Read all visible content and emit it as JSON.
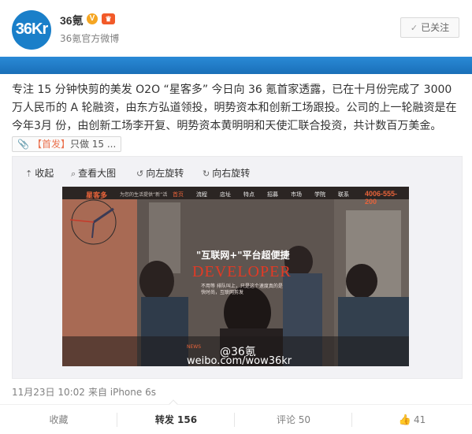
{
  "header": {
    "avatar_text": "36Kr",
    "name": "36氪",
    "verified_badge": "V",
    "member_badge": "♛",
    "subtitle": "36氪官方微博",
    "follow_label": "已关注",
    "follow_check": "✓"
  },
  "post": {
    "text": "专注 15 分钟快剪的美发 O2O “星客多” 今日向 36 氪首家透露，已在十月份完成了 3000 万人民币的 A 轮融资，由东方弘道领投，明势资本和创新工场跟投。公司的上一轮融资是在今年3月 份，由创新工场李开复、明势资本黄明明和天使汇联合投资，共计数百万美金。",
    "tag_clip": "📎",
    "tag_link": "【首发】",
    "tag_rest": "只做 15 ..."
  },
  "media_toolbar": {
    "collapse": "收起",
    "collapse_icon": "⇡",
    "view_large": "查看大图",
    "view_large_icon": "⌕",
    "rotate_left": "向左旋转",
    "rotate_left_icon": "↺",
    "rotate_right": "向右旋转",
    "rotate_right_icon": "↻"
  },
  "image": {
    "logo": "星客多",
    "tagline": "为您的生活提供“新”活",
    "nav": [
      "首页",
      "流程",
      "店址",
      "特点",
      "招募",
      "市场",
      "学院",
      "联系"
    ],
    "phone": "4006-555-200",
    "headline": "\"互联网+\"平台超便捷",
    "developer": "DEVELOPER",
    "sub1": "不用等 排队叫上，只是这个速度真的是",
    "sub2": "快时尚，互联网剪发",
    "news_label": "NEWS",
    "watermark_handle": "@36氪",
    "watermark_url": "weibo.com/wow36kr"
  },
  "meta": {
    "time": "11月23日 10:02",
    "source": "来自 iPhone 6s"
  },
  "actions": {
    "favorite": "收藏",
    "repost": "转发 156",
    "comment": "评论 50",
    "like_icon": "👍",
    "like": "41"
  },
  "colors": {
    "brand_blue": "#1a7fc9",
    "link_orange": "#eb7350",
    "accent_red": "#e23a25"
  }
}
